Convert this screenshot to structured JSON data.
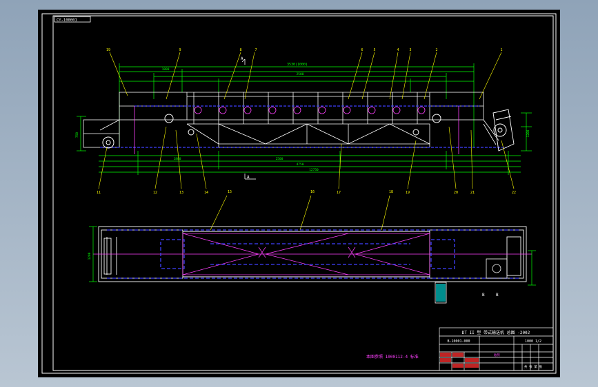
{
  "drawing": {
    "top_label": "CY-100001",
    "side_label": "A",
    "section_label_b": "B",
    "section_label_bb": "B",
    "note": "本图参照 1000112-4 标准",
    "part_numbers_top": [
      "19",
      "9",
      "8",
      "7",
      "6",
      "5",
      "4",
      "3",
      "2",
      "1"
    ],
    "part_numbers_bottom": [
      "11",
      "12",
      "13",
      "14",
      "15",
      "16",
      "17",
      "18",
      "19",
      "20",
      "21",
      "22"
    ],
    "part_numbers_plan": [
      "15",
      "16",
      "18"
    ],
    "dimensions": {
      "overall_top": "3530(1000)",
      "top_inner": "1800",
      "mid_span": "2500",
      "bottom_1": "1800",
      "bottom_2": "2500",
      "bottom_3": "4750",
      "bottom_total": "12750",
      "height_left": "750",
      "height_right": "1200",
      "plan_width": "1200"
    }
  },
  "title_block": {
    "title": "DT II 型  带式输送机  总图  -2002",
    "drawing_no": "B-10001-000",
    "sheet": "1000 1/2",
    "scale_label": "比例",
    "material_label": "共  张  第  张"
  },
  "colors": {
    "frame": "#ffffff",
    "structure": "#ffffff",
    "dimension": "#00ff00",
    "center_line": "#ff40ff",
    "hidden": "#4040ff",
    "leader": "#ffff00",
    "text": "#ffff00",
    "red": "#ff3030",
    "cyan": "#00ffff"
  }
}
